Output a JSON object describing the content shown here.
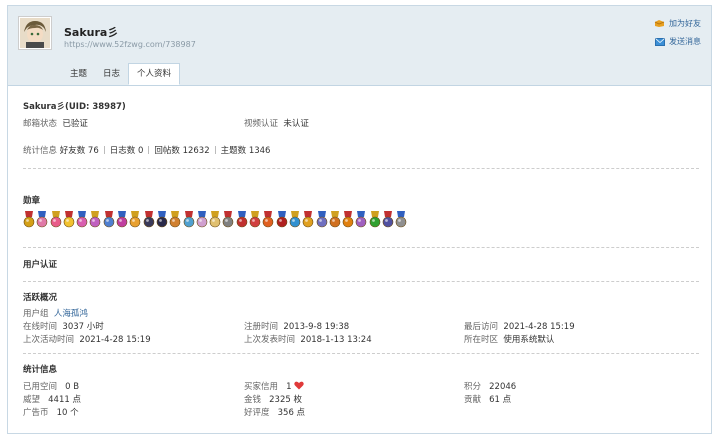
{
  "header": {
    "username": "Sakura彡",
    "url": "https://www.52fzwg.com/738987",
    "add_friend": "加为好友",
    "send_message": "发送消息"
  },
  "tabs": [
    {
      "label": "主题",
      "active": false
    },
    {
      "label": "日志",
      "active": false
    },
    {
      "label": "个人资料",
      "active": true
    }
  ],
  "profile": {
    "name_uid": "Sakura彡(UID: 38987)",
    "email_status_label": "邮箱状态",
    "email_status_value": "已验证",
    "video_label": "视频认证",
    "video_value": "未认证",
    "stats_label": "统计信息",
    "friends": "好友数 76",
    "blogs": "日志数 0",
    "replies": "回帖数 12632",
    "threads": "主题数 1346"
  },
  "medals": {
    "title": "勋章",
    "colors": [
      "#d4a017",
      "#e07aa8",
      "#e85c8a",
      "#f2c230",
      "#d85fb0",
      "#c060c0",
      "#4f7fd0",
      "#c03fa0",
      "#e8a030",
      "#3a3a5a",
      "#2a2a4a",
      "#d08030",
      "#50a0d0",
      "#d0a0d0",
      "#e0c070",
      "#808080",
      "#c03030",
      "#d04040",
      "#e06020",
      "#b02020",
      "#3090d0",
      "#e0a020",
      "#7070c0",
      "#d07020",
      "#e08010",
      "#a060c0",
      "#30a030",
      "#5050a0",
      "#909090"
    ],
    "icons": [
      "medal-icon"
    ]
  },
  "verification": {
    "title": "用户认证"
  },
  "activity": {
    "title": "活跃概况",
    "group_label": "用户组",
    "group_value": "人海孤鸿",
    "online_label": "在线时间",
    "online_value": "3037 小时",
    "register_label": "注册时间",
    "register_value": "2013-9-8 19:38",
    "last_visit_label": "最后访问",
    "last_visit_value": "2021-4-28 15:19",
    "last_active_label": "上次活动时间",
    "last_active_value": "2021-4-28 15:19",
    "last_post_label": "上次发表时间",
    "last_post_value": "2018-1-13 13:24",
    "timezone_label": "所在时区",
    "timezone_value": "使用系统默认"
  },
  "stats": {
    "title": "统计信息",
    "space_label": "已用空间",
    "space_value": "0 B",
    "credit_label": "买家信用",
    "credit_value": "1",
    "points_label": "积分",
    "points_value": "22046",
    "prestige_label": "威望",
    "prestige_value": "4411 点",
    "money_label": "金钱",
    "money_value": "2325 枚",
    "contrib_label": "贡献",
    "contrib_value": "61 点",
    "adcoin_label": "广告币",
    "adcoin_value": "10 个",
    "rating_label": "好评度",
    "rating_value": "356 点"
  }
}
